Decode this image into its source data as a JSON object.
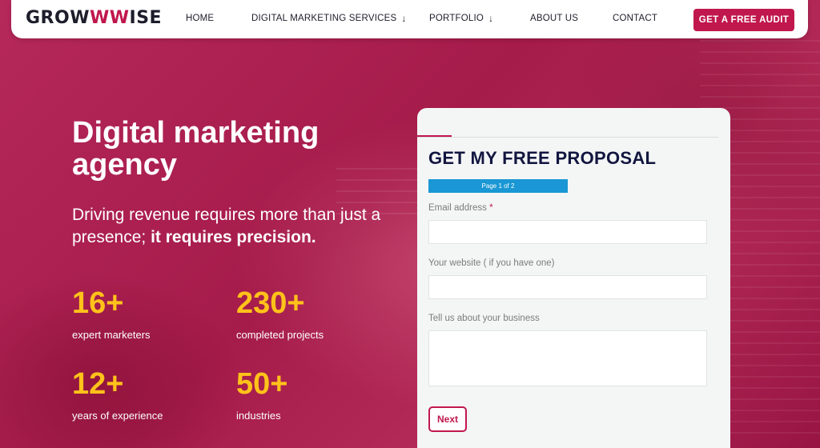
{
  "brand": {
    "logo_prefix": "GROW",
    "logo_accent": "WW",
    "logo_suffix": "ISE",
    "accent_color": "#c0174d"
  },
  "nav": {
    "items": [
      {
        "label": "HOME"
      },
      {
        "label": "DIGITAL MARKETING SERVICES",
        "icon": "arrow-down-icon"
      },
      {
        "label": "PORTFOLIO",
        "icon": "arrow-down-icon"
      },
      {
        "label": "ABOUT US"
      },
      {
        "label": "CONTACT"
      }
    ],
    "cta_label": "GET A FREE AUDIT"
  },
  "hero": {
    "title": "Digital marketing agency",
    "subtitle_plain": "Driving revenue requires more than just a presence; ",
    "subtitle_bold": "it requires precision.",
    "stats": [
      {
        "value": "16+",
        "label": "expert marketers"
      },
      {
        "value": "230+",
        "label": "completed projects"
      },
      {
        "value": "12+",
        "label": "years of experience"
      },
      {
        "value": "50+",
        "label": "industries"
      }
    ]
  },
  "form": {
    "title": "GET MY FREE PROPOSAL",
    "progress_text": "Page 1 of 2",
    "fields": [
      {
        "label": "Email address",
        "required_mark": "*",
        "value": ""
      },
      {
        "label": "Your website ( if you have one)",
        "value": ""
      },
      {
        "label": "Tell us about your business",
        "value": ""
      }
    ],
    "next_label": "Next"
  }
}
